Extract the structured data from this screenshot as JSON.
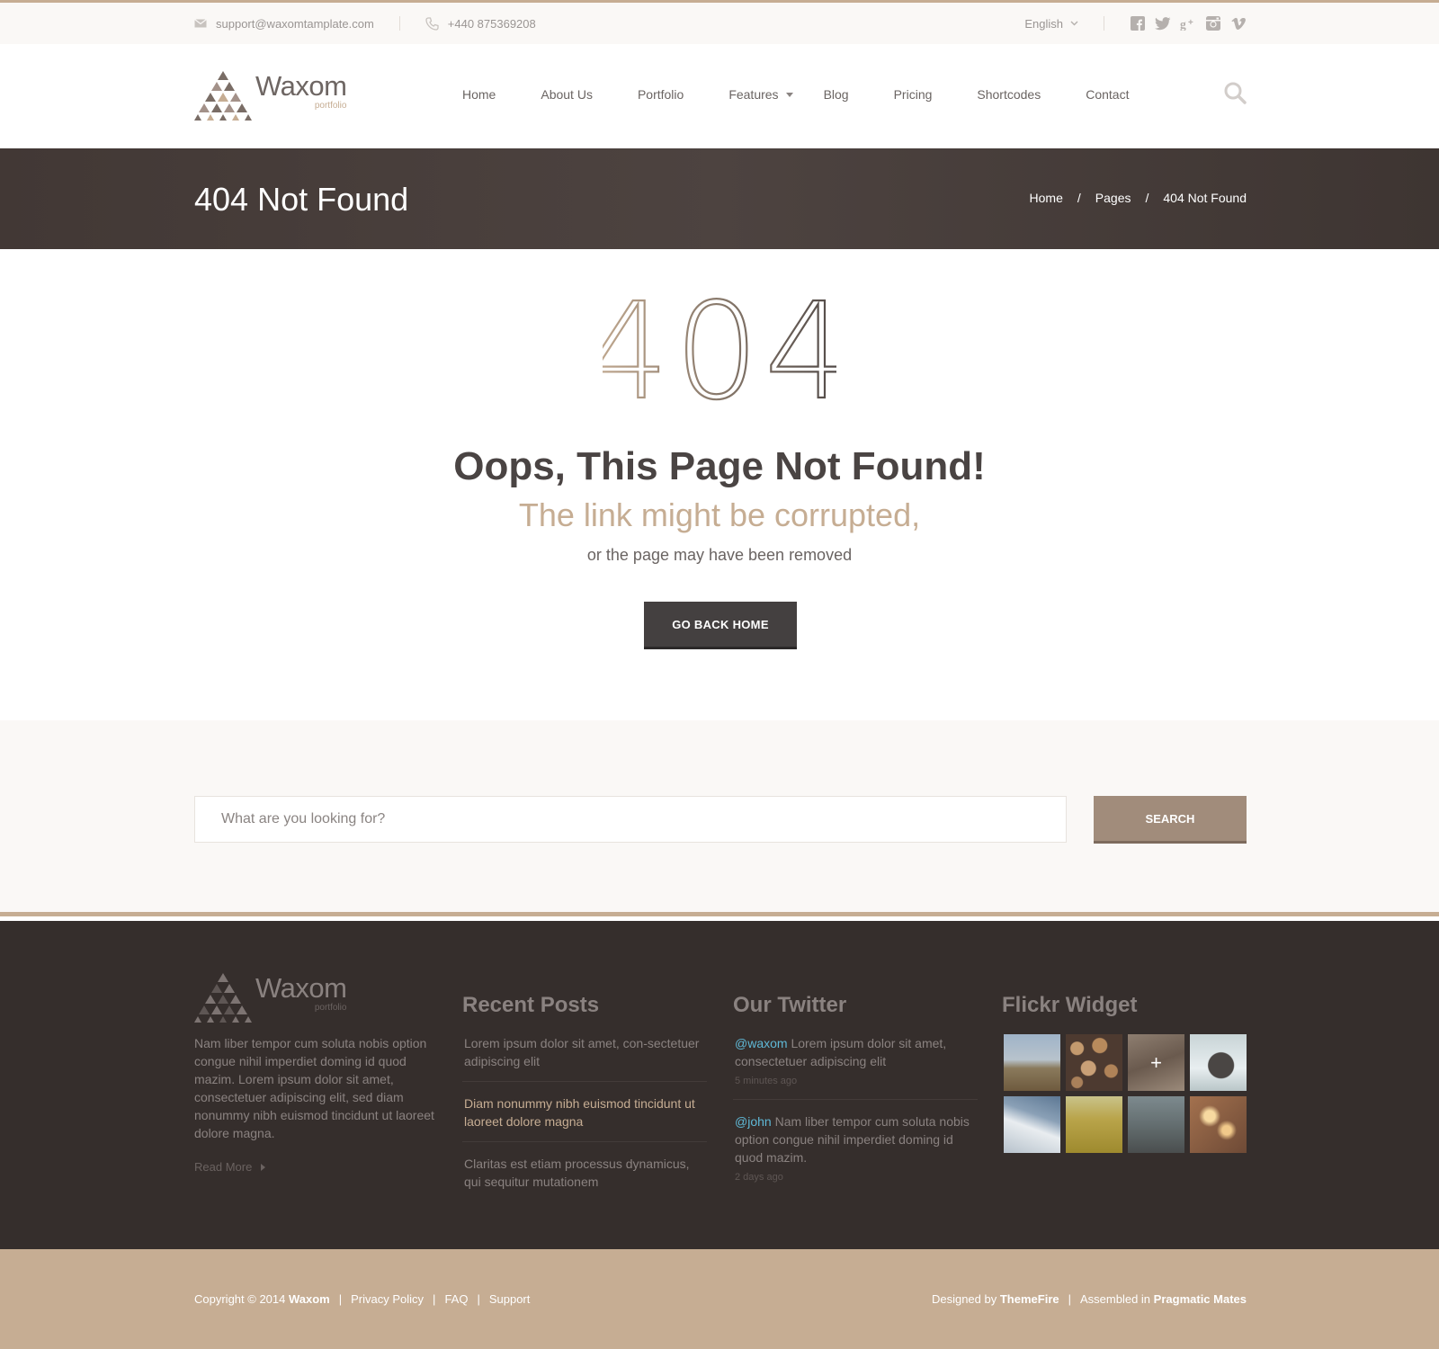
{
  "topbar": {
    "email": "support@waxomtamplate.com",
    "phone": "+440 875369208",
    "language": "English",
    "socials": [
      "facebook-icon",
      "twitter-icon",
      "google-plus-icon",
      "instagram-icon",
      "vimeo-icon"
    ]
  },
  "header": {
    "logo_name": "Waxom",
    "logo_sub": "portfolio",
    "nav": [
      "Home",
      "About Us",
      "Portfolio",
      "Features",
      "Blog",
      "Pricing",
      "Shortcodes",
      "Contact"
    ]
  },
  "titlebar": {
    "title": "404 Not Found",
    "breadcrumb": [
      "Home",
      "Pages",
      "404 Not Found"
    ],
    "separator": "/"
  },
  "error": {
    "code": "404",
    "heading": "Oops, This Page Not Found!",
    "subheading": "The link might be corrupted,",
    "note": "or the page may have been removed",
    "button": "GO BACK HOME"
  },
  "search": {
    "placeholder": "What are you looking for?",
    "button": "SEARCH"
  },
  "footer": {
    "logo_name": "Waxom",
    "logo_sub": "portfolio",
    "about": "Nam liber tempor cum soluta nobis option congue nihil imperdiet doming id quod mazim. Lorem ipsum dolor sit amet, consectetuer adipiscing elit, sed diam nonummy nibh euismod tincidunt ut laoreet dolore magna.",
    "read_more": "Read More",
    "recent_title": "Recent Posts",
    "posts": [
      "Lorem ipsum dolor sit amet, con-sectetuer adipiscing elit",
      "Diam nonummy nibh euismod tincidunt ut laoreet dolore magna",
      "Claritas est etiam processus dynamicus, qui sequitur mutationem"
    ],
    "twitter_title": "Our Twitter",
    "tweets": [
      {
        "user": "@waxom",
        "text": " Lorem ipsum dolor sit amet, consectetuer adipiscing elit",
        "time": "5 minutes ago"
      },
      {
        "user": "@john",
        "text": " Nam liber tempor cum soluta nobis option congue nihil imperdiet doming id quod mazim.",
        "time": "2 days ago"
      }
    ],
    "flickr_title": "Flickr Widget"
  },
  "bottom": {
    "copyright_prefix": "Copyright © 2014",
    "brand": "Waxom",
    "links": [
      "Privacy Policy",
      "FAQ",
      "Support"
    ],
    "designed_by": "Designed by",
    "designer": "ThemeFire",
    "assembled_in": "Assembled in",
    "assembler": "Pragmatic Mates"
  },
  "colors": {
    "accent": "#c6ad93",
    "dark": "#352e2c",
    "button": "#444040",
    "search_button": "#a18c7b",
    "twitter_user": "#5fb8d6"
  }
}
